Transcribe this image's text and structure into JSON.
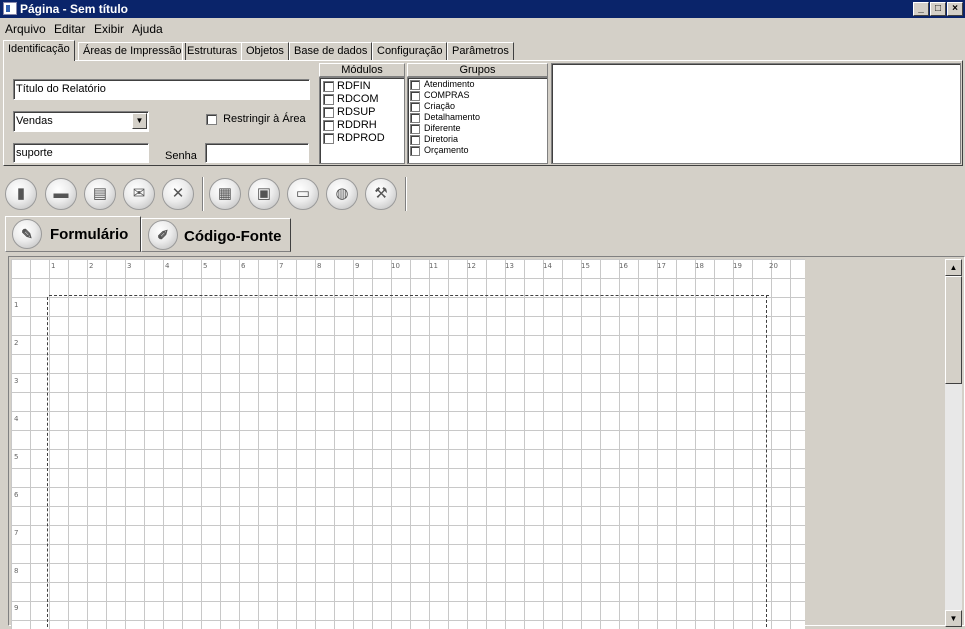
{
  "window": {
    "title": "Página - Sem título",
    "buttons": [
      "_",
      "□",
      "×"
    ]
  },
  "menu": [
    "Arquivo",
    "Editar",
    "Exibir",
    "Ajuda"
  ],
  "tabs": [
    "Identificação",
    "Áreas de Impressão",
    "Estruturas",
    "Objetos",
    "Base de dados",
    "Configuração",
    "Parâmetros"
  ],
  "form": {
    "title_value": "Título do Relatório",
    "area_value": "Vendas",
    "restrict_label": "Restringir à Área",
    "user_value": "suporte",
    "password_label": "Senha",
    "password_value": ""
  },
  "modulos": {
    "header": "Módulos",
    "items": [
      "RDFIN",
      "RDCOM",
      "RDSUP",
      "RDDRH",
      "RDPROD"
    ]
  },
  "grupos": {
    "header": "Grupos",
    "items": [
      "Atendimento",
      "COMPRAS",
      "Criação",
      "Detalhamento",
      "Diferente",
      "Diretoria",
      "Orçamento"
    ]
  },
  "toolbar": {
    "icons": [
      "new-document-icon",
      "open-folder-icon",
      "save-icon",
      "email-icon",
      "delete-icon",
      "print-preview-icon",
      "print-icon",
      "screen-icon",
      "web-icon",
      "build-icon"
    ]
  },
  "view_tabs": {
    "form": "Formulário",
    "source": "Código-Fonte"
  },
  "ruler": {
    "top": [
      "1",
      "2",
      "3",
      "4",
      "5",
      "6",
      "7",
      "8",
      "9",
      "10",
      "11",
      "12",
      "13",
      "14",
      "15",
      "16",
      "17",
      "18",
      "19",
      "20"
    ],
    "left": [
      "1",
      "2",
      "3",
      "4",
      "5",
      "6",
      "7",
      "8",
      "9"
    ]
  }
}
